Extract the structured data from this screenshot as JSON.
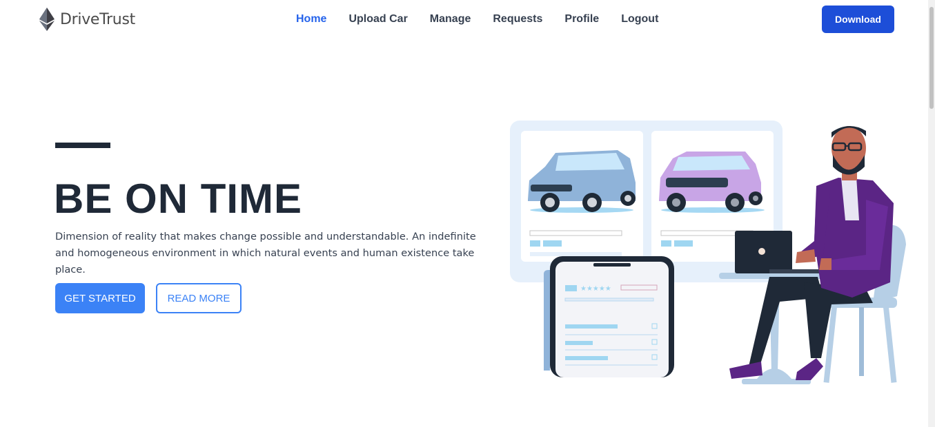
{
  "header": {
    "brand": "DriveTrust",
    "nav": [
      {
        "label": "Home",
        "active": true
      },
      {
        "label": "Upload Car",
        "active": false
      },
      {
        "label": "Manage",
        "active": false
      },
      {
        "label": "Requests",
        "active": false
      },
      {
        "label": "Profile",
        "active": false
      },
      {
        "label": "Logout",
        "active": false
      }
    ],
    "download_label": "Download"
  },
  "hero": {
    "title": "BE ON TIME",
    "description": "Dimension of reality that makes change possible and understandable. An indefinite and homogeneous environment in which natural events and human existence take place.",
    "primary_button": "GET STARTED",
    "secondary_button": "READ MORE"
  },
  "colors": {
    "primary": "#3b82f6",
    "download": "#1d4ed8",
    "nav_active": "#2563eb",
    "heading": "#1f2937"
  },
  "icons": {
    "logo": "ethereum-diamond-icon"
  }
}
